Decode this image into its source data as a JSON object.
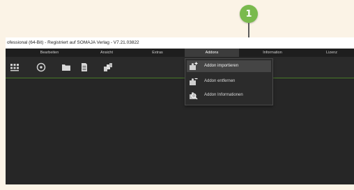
{
  "callout": {
    "number": "1"
  },
  "window": {
    "title": "ofessional (64-Bit) - Registriert auf SOMAJA Verlag - V7.21.03822"
  },
  "menubar": {
    "items": [
      {
        "label": "Bearbeiten"
      },
      {
        "label": "Ansicht"
      },
      {
        "label": "Extras"
      },
      {
        "label": "Addons"
      },
      {
        "label": "Information"
      },
      {
        "label": "Lizenz"
      }
    ]
  },
  "toolbar": {
    "icons": [
      "grid-view-icon",
      "disc-icon",
      "folder-icon",
      "document-icon",
      "stack-icon"
    ]
  },
  "addons_menu": {
    "items": [
      {
        "label": "Addon importieren",
        "icon": "puzzle-plus-icon"
      },
      {
        "label": "Addon entfernen",
        "icon": "puzzle-minus-icon"
      },
      {
        "label": "Addon Informationen",
        "icon": "puzzle-search-icon"
      }
    ]
  },
  "colors": {
    "badge": "#7aba4e",
    "accent_line": "#4a7a2a",
    "app_background": "#262626",
    "page_background": "#fbf3e6"
  }
}
